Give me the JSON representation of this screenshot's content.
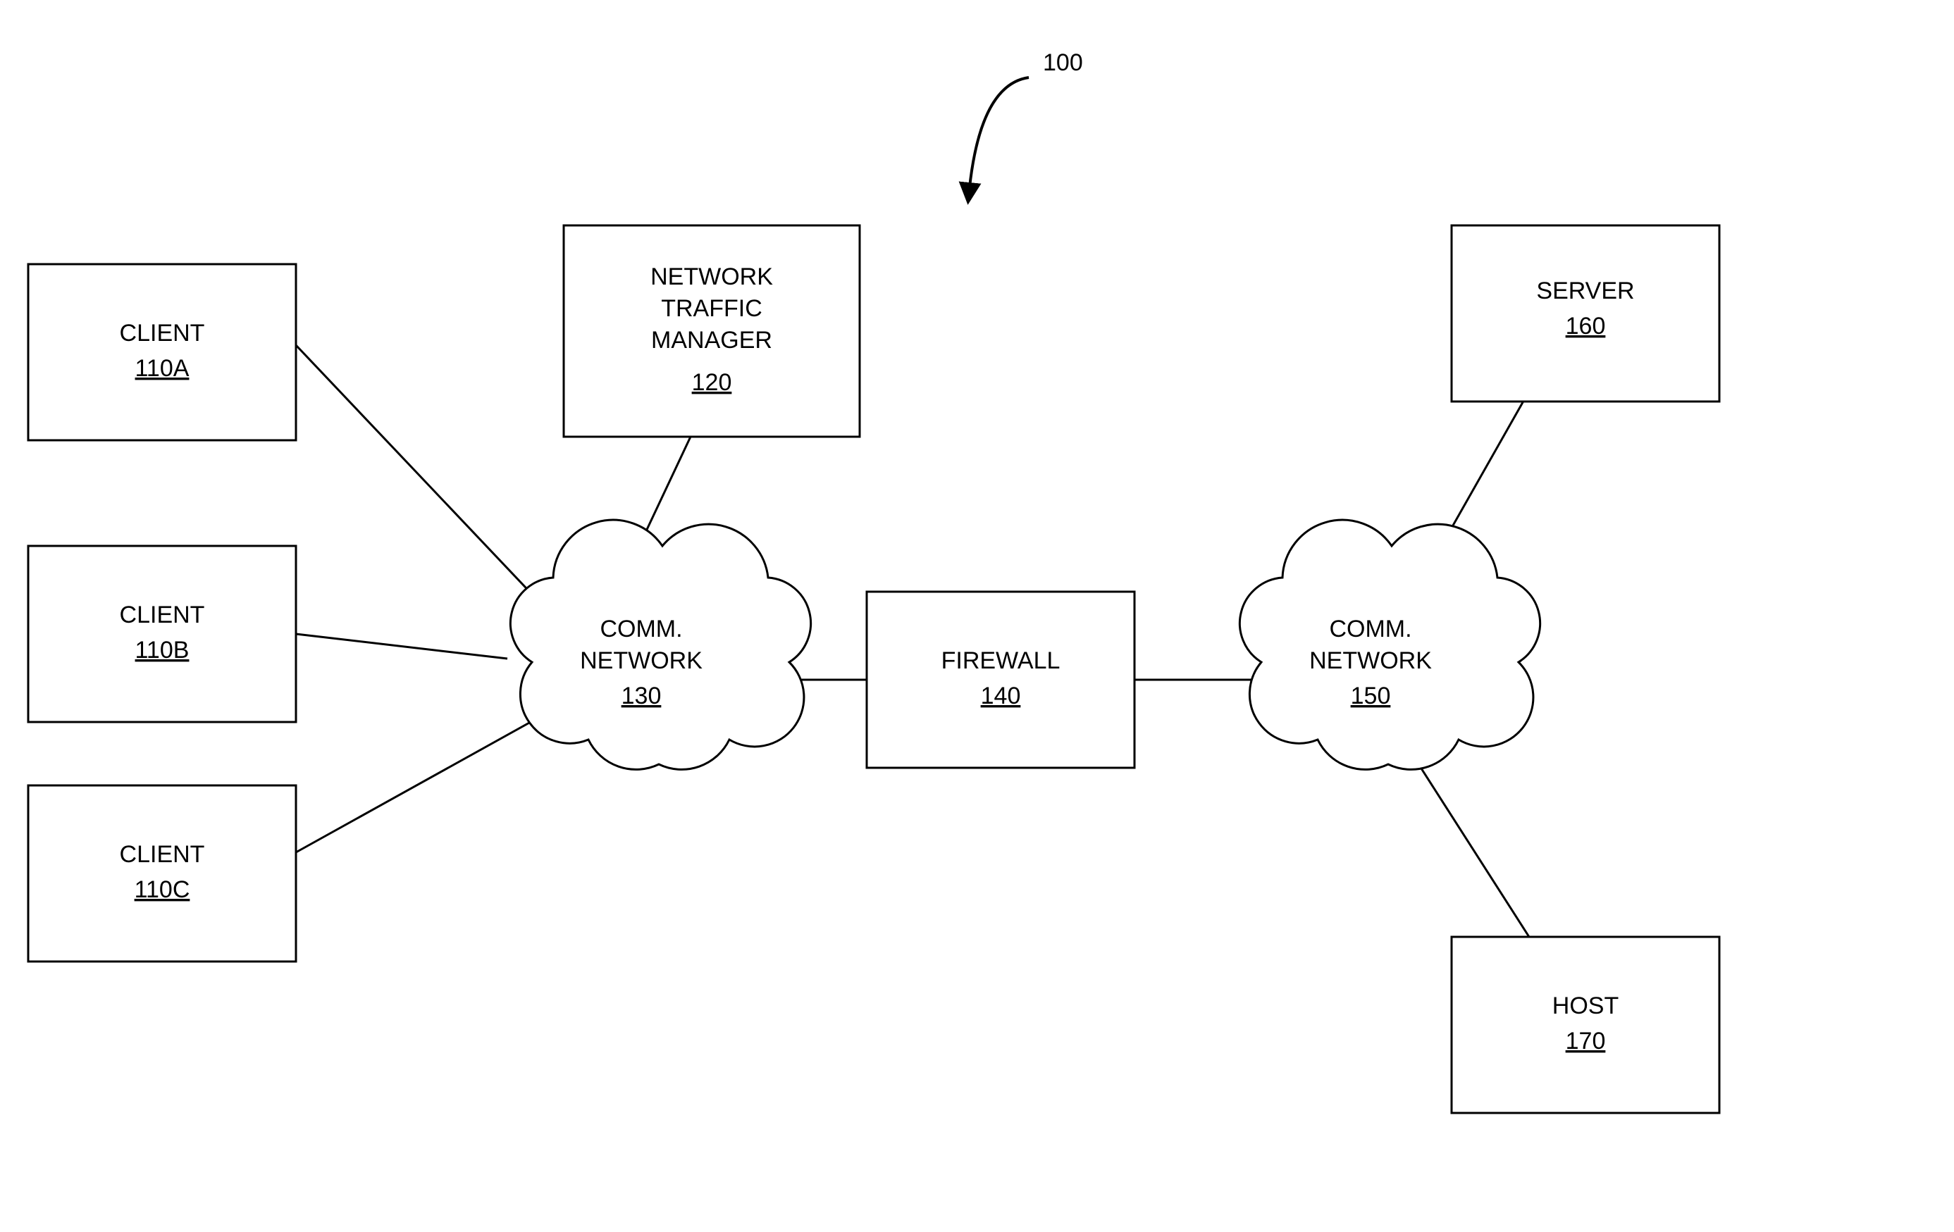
{
  "figure": {
    "ref": "100"
  },
  "nodes": {
    "clientA": {
      "label": "CLIENT",
      "ref": "110A"
    },
    "clientB": {
      "label": "CLIENT",
      "ref": "110B"
    },
    "clientC": {
      "label": "CLIENT",
      "ref": "110C"
    },
    "ntm": {
      "line1": "NETWORK",
      "line2": "TRAFFIC",
      "line3": "MANAGER",
      "ref": "120"
    },
    "net1": {
      "line1": "COMM.",
      "line2": "NETWORK",
      "ref": "130"
    },
    "firewall": {
      "label": "FIREWALL",
      "ref": "140"
    },
    "net2": {
      "line1": "COMM.",
      "line2": "NETWORK",
      "ref": "150"
    },
    "server": {
      "label": "SERVER",
      "ref": "160"
    },
    "host": {
      "label": "HOST",
      "ref": "170"
    }
  }
}
